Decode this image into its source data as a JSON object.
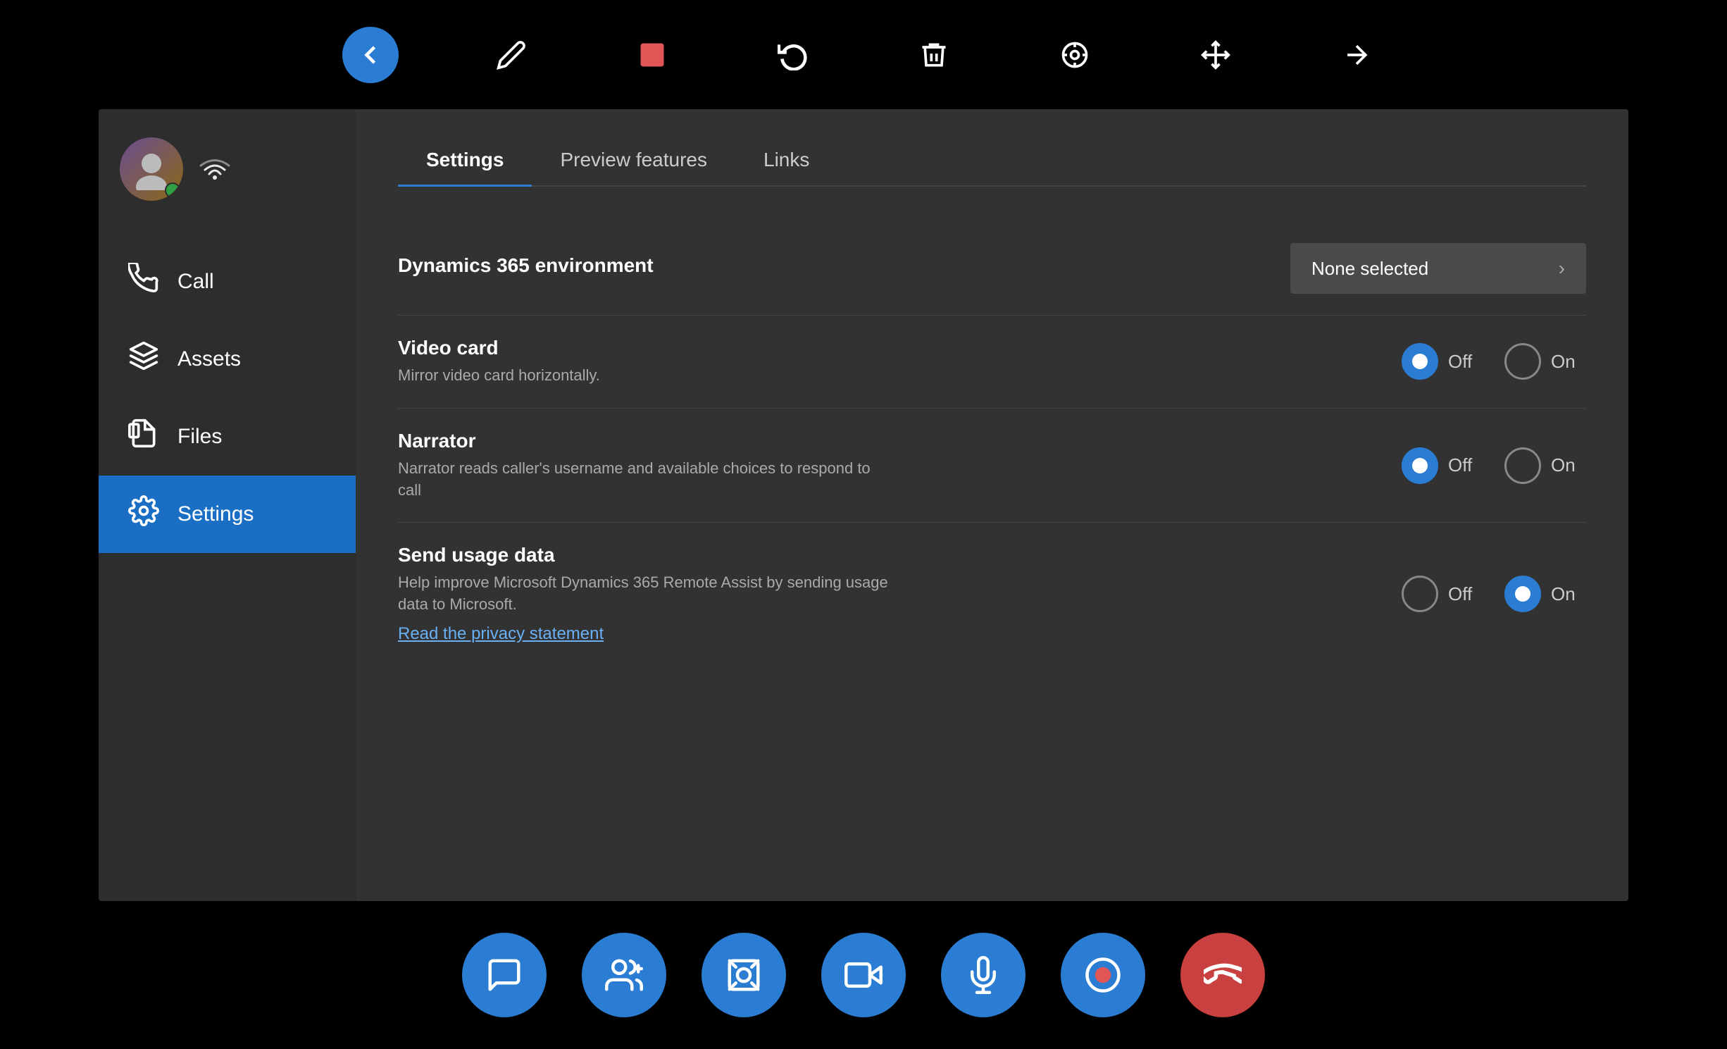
{
  "toolbar_top": {
    "buttons": [
      {
        "id": "back-btn",
        "icon": "back",
        "color": "blue"
      },
      {
        "id": "pen-btn",
        "icon": "pen",
        "color": "default"
      },
      {
        "id": "stop-btn",
        "icon": "stop",
        "color": "default"
      },
      {
        "id": "undo-btn",
        "icon": "undo",
        "color": "default"
      },
      {
        "id": "delete-btn",
        "icon": "delete",
        "color": "default"
      },
      {
        "id": "pin-btn",
        "icon": "pin",
        "color": "default"
      },
      {
        "id": "move-btn",
        "icon": "move",
        "color": "default"
      },
      {
        "id": "unpin-btn",
        "icon": "unpin",
        "color": "default"
      }
    ]
  },
  "sidebar": {
    "nav_items": [
      {
        "id": "call",
        "label": "Call",
        "icon": "call",
        "active": false
      },
      {
        "id": "assets",
        "label": "Assets",
        "icon": "assets",
        "active": false
      },
      {
        "id": "files",
        "label": "Files",
        "icon": "files",
        "active": false
      },
      {
        "id": "settings",
        "label": "Settings",
        "icon": "settings",
        "active": true
      }
    ]
  },
  "content": {
    "tabs": [
      {
        "id": "settings-tab",
        "label": "Settings",
        "active": true
      },
      {
        "id": "preview-tab",
        "label": "Preview features",
        "active": false
      },
      {
        "id": "links-tab",
        "label": "Links",
        "active": false
      }
    ],
    "settings": {
      "dynamics_env": {
        "label": "Dynamics 365 environment",
        "value": "None selected"
      },
      "video_card": {
        "label": "Video card",
        "sublabel": "Mirror video card horizontally.",
        "off_selected": true,
        "on_selected": false
      },
      "narrator": {
        "label": "Narrator",
        "sublabel": "Narrator reads caller's username and available choices to respond to call",
        "off_selected": true,
        "on_selected": false
      },
      "send_usage_data": {
        "label": "Send usage data",
        "sublabel": "Help improve Microsoft Dynamics 365 Remote Assist by sending usage data to Microsoft.",
        "off_selected": false,
        "on_selected": true,
        "privacy_link": "Read the privacy statement"
      }
    }
  },
  "bottom_toolbar": {
    "buttons": [
      {
        "id": "chat-btn",
        "icon": "chat"
      },
      {
        "id": "participants-btn",
        "icon": "participants"
      },
      {
        "id": "screenshot-btn",
        "icon": "screenshot"
      },
      {
        "id": "video-btn",
        "icon": "video"
      },
      {
        "id": "mic-btn",
        "icon": "mic"
      },
      {
        "id": "record-btn",
        "icon": "record"
      },
      {
        "id": "hangup-btn",
        "icon": "hangup",
        "color": "red"
      }
    ]
  }
}
